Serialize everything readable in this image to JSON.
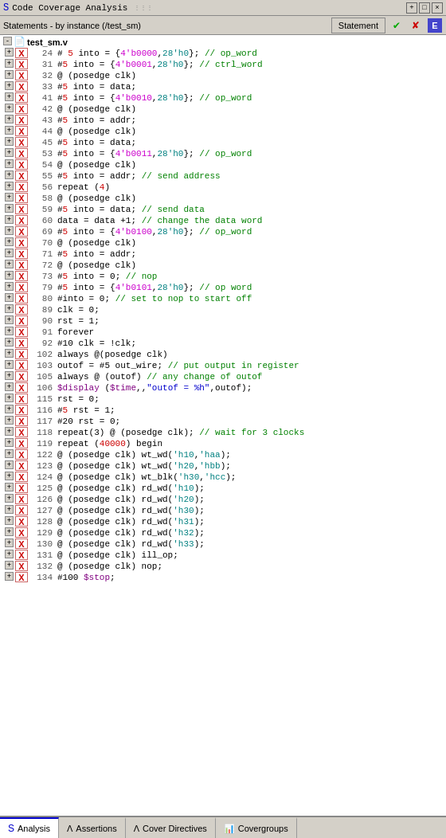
{
  "titlebar": {
    "title": "Code Coverage Analysis",
    "controls": [
      "+",
      "□",
      "×"
    ]
  },
  "toolbar": {
    "subtitle": "Statements - by instance (/test_sm)",
    "statement_btn": "Statement",
    "icon_check": "✔",
    "icon_x": "✘",
    "icon_e": "E"
  },
  "tree": {
    "root": "test_sm.v",
    "rows": [
      {
        "indent": 0,
        "type": "plus",
        "has_x": false,
        "line": "",
        "code": "",
        "root_node": true
      },
      {
        "indent": 1,
        "type": "xs",
        "line": "24",
        "code": "# 5 into = {4'b0000,28'h0}; // op_word"
      },
      {
        "indent": 1,
        "type": "xs",
        "line": "31",
        "code": "#5 into = {4'b0001,28'h0}; // ctrl_word"
      },
      {
        "indent": 1,
        "type": "xs",
        "line": "32",
        "code": "@ (posedge clk)"
      },
      {
        "indent": 1,
        "type": "xs",
        "line": "33",
        "code": "#5 into = data;"
      },
      {
        "indent": 1,
        "type": "xs",
        "line": "41",
        "code": "#5 into = {4'b0010,28'h0}; // op_word"
      },
      {
        "indent": 1,
        "type": "xs",
        "line": "42",
        "code": "@ (posedge clk)"
      },
      {
        "indent": 1,
        "type": "xs",
        "line": "43",
        "code": "#5 into = addr;"
      },
      {
        "indent": 1,
        "type": "xs",
        "line": "44",
        "code": "@ (posedge clk)"
      },
      {
        "indent": 1,
        "type": "xs",
        "line": "45",
        "code": "#5 into = data;"
      },
      {
        "indent": 1,
        "type": "xs",
        "line": "53",
        "code": "#5 into = {4'b0011,28'h0}; // op_word"
      },
      {
        "indent": 1,
        "type": "xs",
        "line": "54",
        "code": "@ (posedge clk)"
      },
      {
        "indent": 1,
        "type": "xs",
        "line": "55",
        "code": "#5 into = addr; // send address"
      },
      {
        "indent": 1,
        "type": "xs",
        "line": "56",
        "code": "repeat (4)"
      },
      {
        "indent": 1,
        "type": "xs",
        "line": "58",
        "code": "@ (posedge clk)"
      },
      {
        "indent": 1,
        "type": "xs",
        "line": "59",
        "code": "#5 into = data; // send data"
      },
      {
        "indent": 1,
        "type": "xs",
        "line": "60",
        "code": "data = data +1; // change the data word"
      },
      {
        "indent": 1,
        "type": "xs",
        "line": "69",
        "code": "#5 into = {4'b0100,28'h0}; // op_word"
      },
      {
        "indent": 1,
        "type": "xs",
        "line": "70",
        "code": "@ (posedge clk)"
      },
      {
        "indent": 1,
        "type": "xs",
        "line": "71",
        "code": "#5 into = addr;"
      },
      {
        "indent": 1,
        "type": "xs",
        "line": "72",
        "code": "@ (posedge clk)"
      },
      {
        "indent": 1,
        "type": "xs",
        "line": "73",
        "code": "#5 into = 0;  // nop"
      },
      {
        "indent": 1,
        "type": "xs",
        "line": "79",
        "code": "#5 into = {4'b0101,28'h0};  // op word"
      },
      {
        "indent": 1,
        "type": "xs",
        "line": "80",
        "code": "#into = 0; // set to nop to start off"
      },
      {
        "indent": 1,
        "type": "xs",
        "line": "89",
        "code": "clk = 0;"
      },
      {
        "indent": 1,
        "type": "xs",
        "line": "90",
        "code": "rst = 1;"
      },
      {
        "indent": 1,
        "type": "xs",
        "line": "91",
        "code": "forever"
      },
      {
        "indent": 1,
        "type": "xs_plus",
        "line": "92",
        "code": "#10 clk = !clk;"
      },
      {
        "indent": 1,
        "type": "xs",
        "line": "102",
        "code": "always @(posedge clk)"
      },
      {
        "indent": 1,
        "type": "xs",
        "line": "103",
        "code": "outof = #5 out_wire; // put output in register"
      },
      {
        "indent": 1,
        "type": "xs",
        "line": "105",
        "code": "always @ (outof)  // any change of outof"
      },
      {
        "indent": 1,
        "type": "xs",
        "line": "106",
        "code": "$display ($time,,\"outof = %h\",outof);"
      },
      {
        "indent": 1,
        "type": "xs",
        "line": "115",
        "code": "rst = 0;"
      },
      {
        "indent": 1,
        "type": "xs_plus",
        "line": "116",
        "code": "#5 rst = 1;"
      },
      {
        "indent": 1,
        "type": "xs",
        "line": "117",
        "code": "#20 rst = 0;"
      },
      {
        "indent": 1,
        "type": "xs",
        "line": "118",
        "code": "repeat(3) @ (posedge clk); // wait for 3 clocks"
      },
      {
        "indent": 1,
        "type": "xs",
        "line": "119",
        "code": "repeat (40000) begin"
      },
      {
        "indent": 1,
        "type": "xs",
        "line": "122",
        "code": "@ (posedge clk) wt_wd('h10,'haa);"
      },
      {
        "indent": 1,
        "type": "xs",
        "line": "123",
        "code": "@ (posedge clk) wt_wd('h20,'hbb);"
      },
      {
        "indent": 1,
        "type": "xs",
        "line": "124",
        "code": "@ (posedge clk) wt_blk('h30,'hcc);"
      },
      {
        "indent": 1,
        "type": "xs",
        "line": "125",
        "code": "@ (posedge clk) rd_wd('h10);"
      },
      {
        "indent": 1,
        "type": "xs",
        "line": "126",
        "code": "@ (posedge clk) rd_wd('h20);"
      },
      {
        "indent": 1,
        "type": "xs",
        "line": "127",
        "code": "@ (posedge clk) rd_wd('h30);"
      },
      {
        "indent": 1,
        "type": "xs",
        "line": "128",
        "code": "@ (posedge clk) rd_wd('h31);"
      },
      {
        "indent": 1,
        "type": "xs",
        "line": "129",
        "code": "@ (posedge clk) rd_wd('h32);"
      },
      {
        "indent": 1,
        "type": "xs",
        "line": "130",
        "code": "@ (posedge clk) rd_wd('h33);"
      },
      {
        "indent": 1,
        "type": "xs",
        "line": "131",
        "code": "@ (posedge clk) ill_op;"
      },
      {
        "indent": 1,
        "type": "xs",
        "line": "132",
        "code": "@ (posedge clk) nop;"
      },
      {
        "indent": 1,
        "type": "xs",
        "line": "134",
        "code": "#100 $stop;"
      }
    ]
  },
  "tabs": [
    {
      "label": "Analysis",
      "icon": "📊",
      "active": true
    },
    {
      "label": "Assertions",
      "icon": "Λ",
      "active": false
    },
    {
      "label": "Cover Directives",
      "icon": "Λ",
      "active": false
    },
    {
      "label": "Covergroups",
      "icon": "📊",
      "active": false
    }
  ]
}
